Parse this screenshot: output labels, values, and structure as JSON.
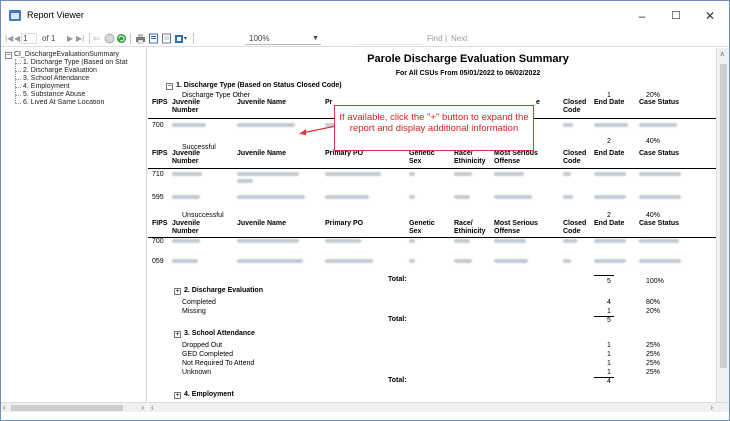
{
  "window": {
    "title": "Report Viewer",
    "minimize": "–",
    "maximize": "☐",
    "close": "✕"
  },
  "toolbar": {
    "page_current": "1",
    "page_of": "of 1",
    "zoom": "100%",
    "find_label": "Find",
    "next_label": "Next"
  },
  "docmap": {
    "root": "CI_DischargeEvaluationSummary",
    "items": [
      {
        "label": "1. Discharge Type (Based on Stat"
      },
      {
        "label": "2. Discharge Evaluation"
      },
      {
        "label": "3. School Attendance"
      },
      {
        "label": "4. Employment"
      },
      {
        "label": "5. Substance Abuse"
      },
      {
        "label": "6. Lived At Same Location"
      }
    ]
  },
  "report": {
    "title": "Parole Discharge Evaluation Summary",
    "subtitle": "For All CSUs From 05/01/2022 to 06/02/2022",
    "annotation": "If available, click the \"+\" button to expand the report and display additional information",
    "section1": {
      "heading": "1. Discharge Type (Based on Status Closed Code)",
      "total_label": "Total:",
      "total_count": "5",
      "total_pct": "100%",
      "columns": {
        "fips": "FIPS",
        "juvenile_number": "Juvenile Number",
        "juvenile_name": "Juvenile Name",
        "primary_po": "Primary PO",
        "primary_po_cut": "Pr",
        "genetic_sex": "Genetic Sex",
        "race": "Race/ Ethinicity",
        "offense": "Most Serious Offense",
        "offense_cut": "e",
        "closed_code": "Closed Code",
        "end_date": "End Date",
        "case_status": "Case Status"
      },
      "groups": [
        {
          "label": "Discharge Type Other",
          "count": "1",
          "pct": "20%",
          "fips": [
            "700"
          ]
        },
        {
          "label": "Successful",
          "count": "2",
          "pct": "40%",
          "fips": [
            "710",
            "595"
          ]
        },
        {
          "label": "Unsuccessful",
          "count": "2",
          "pct": "40%",
          "fips": [
            "700",
            "059"
          ]
        }
      ]
    },
    "section2": {
      "heading": "2. Discharge Evaluation",
      "rows": [
        {
          "label": "Completed",
          "count": "4",
          "pct": "80%"
        },
        {
          "label": "Missing",
          "count": "1",
          "pct": "20%"
        }
      ],
      "total_label": "Total:",
      "total_count": "5"
    },
    "section3": {
      "heading": "3. School Attendance",
      "rows": [
        {
          "label": "Dropped Out",
          "count": "1",
          "pct": "25%"
        },
        {
          "label": "GED Completed",
          "count": "1",
          "pct": "25%"
        },
        {
          "label": "Not Required To Attend",
          "count": "1",
          "pct": "25%"
        },
        {
          "label": "Unknown",
          "count": "1",
          "pct": "25%"
        }
      ],
      "total_label": "Total:",
      "total_count": "4"
    },
    "section4": {
      "heading": "4. Employment"
    }
  },
  "colors": {
    "annotation_red": "#d92323",
    "arrow_red": "#d23c3c"
  }
}
